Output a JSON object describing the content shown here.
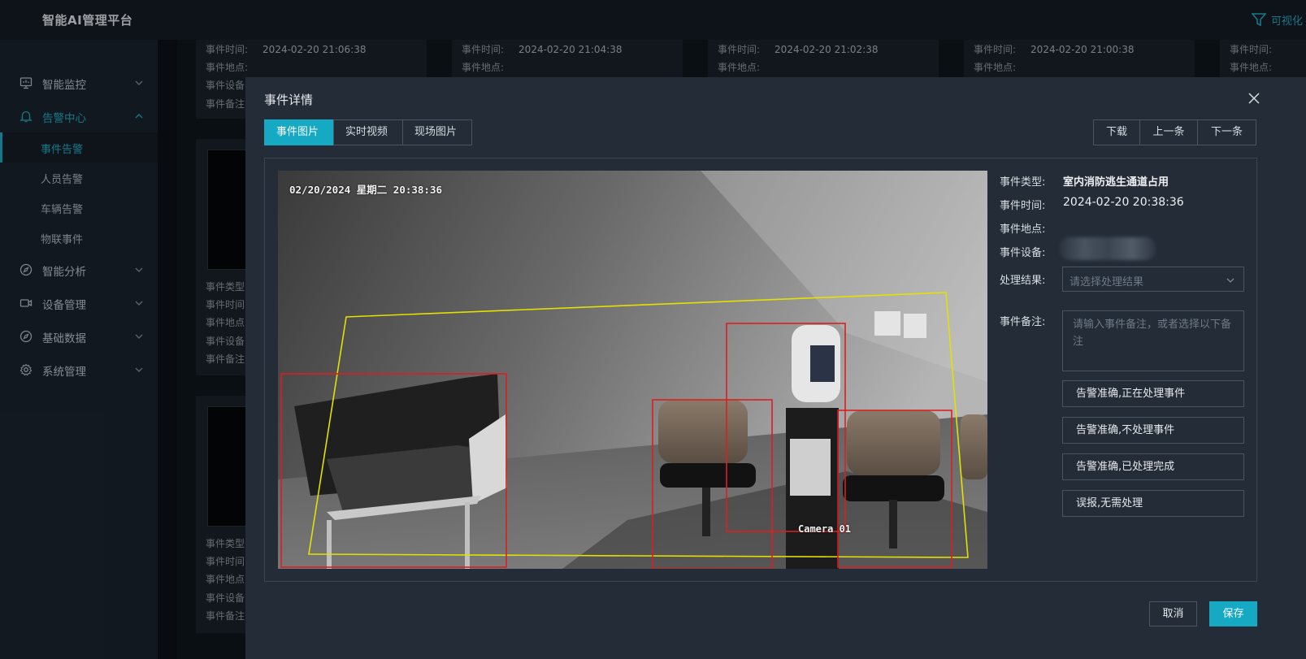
{
  "app": {
    "title": "智能AI管理平台",
    "vis_link": "可视化"
  },
  "sidebar": {
    "items": [
      {
        "label": "智能监控",
        "icon": "monitor-icon"
      },
      {
        "label": "告警中心",
        "icon": "bell-icon",
        "expanded": true,
        "children": [
          {
            "label": "事件告警",
            "selected": true
          },
          {
            "label": "人员告警"
          },
          {
            "label": "车辆告警"
          },
          {
            "label": "物联事件"
          }
        ]
      },
      {
        "label": "智能分析",
        "icon": "compass-icon"
      },
      {
        "label": "设备管理",
        "icon": "camera-icon"
      },
      {
        "label": "基础数据",
        "icon": "compass-icon"
      },
      {
        "label": "系统管理",
        "icon": "gear-icon"
      }
    ]
  },
  "background_cards": {
    "top_row": [
      {
        "time_label": "事件时间:",
        "time": "2024-02-20 21:06:38",
        "place_label": "事件地点:",
        "device_label": "事件设备:",
        "note_label": "事件备注:"
      },
      {
        "time_label": "事件时间:",
        "time": "2024-02-20 21:04:38",
        "place_label": "事件地点:"
      },
      {
        "time_label": "事件时间:",
        "time": "2024-02-20 21:02:38",
        "place_label": "事件地点:"
      },
      {
        "time_label": "事件时间:",
        "time": "2024-02-20 21:00:38",
        "place_label": "事件地点:"
      },
      {
        "time_label": "事件时间:",
        "place_label": "事件地点:"
      }
    ],
    "left_column": [
      {
        "type_label": "事件类型:",
        "time_label": "事件时间:",
        "place_label": "事件地点:",
        "device_label": "事件设备:",
        "note_label": "事件备注:"
      },
      {
        "type_label": "事件类型:",
        "time_label": "事件时间:",
        "place_label": "事件地点:",
        "device_label": "事件设备:",
        "note_label": "事件备注:"
      }
    ]
  },
  "modal": {
    "title": "事件详情",
    "tabs": [
      {
        "label": "事件图片",
        "active": true
      },
      {
        "label": "实时视频"
      },
      {
        "label": "现场图片"
      }
    ],
    "nav": {
      "download": "下载",
      "prev": "上一条",
      "next": "下一条"
    },
    "image": {
      "timestamp": "02/20/2024 星期二 20:38:36",
      "camera": "Camera 01"
    },
    "info": {
      "type_label": "事件类型:",
      "type": "室内消防逃生通道占用",
      "time_label": "事件时间:",
      "time": "2024-02-20 20:38:36",
      "place_label": "事件地点:",
      "place": "",
      "device_label": "事件设备:",
      "result_label": "处理结果:",
      "result_placeholder": "请选择处理结果",
      "note_label": "事件备注:",
      "note_placeholder": "请输入事件备注，或者选择以下备注"
    },
    "quick_actions": [
      "告警准确,正在处理事件",
      "告警准确,不处理事件",
      "告警准确,已处理完成",
      "误报,无需处理"
    ],
    "footer": {
      "cancel": "取消",
      "save": "保存"
    }
  },
  "colors": {
    "accent": "#16a9c4",
    "detection_box": "#d9201e",
    "zone_line": "#e4e000"
  }
}
